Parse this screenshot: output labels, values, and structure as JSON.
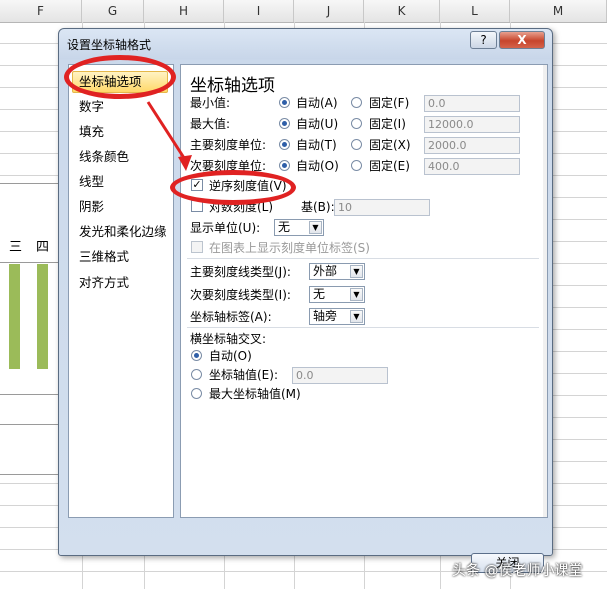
{
  "sheet": {
    "columns": [
      "F",
      "G",
      "H",
      "I",
      "J",
      "K",
      "L",
      "M"
    ],
    "chart_labels": [
      "三",
      "四"
    ]
  },
  "dialog": {
    "title": "设置坐标轴格式",
    "help_label": "?",
    "close_label": "X",
    "nav_items": [
      "坐标轴选项",
      "数字",
      "填充",
      "线条颜色",
      "线型",
      "阴影",
      "发光和柔化边缘",
      "三维格式",
      "对齐方式"
    ],
    "section_title": "坐标轴选项",
    "rows": {
      "min": {
        "label": "最小值:",
        "auto": "自动(A)",
        "fixed": "固定(F)",
        "value": "0.0"
      },
      "max": {
        "label": "最大值:",
        "auto": "自动(U)",
        "fixed": "固定(I)",
        "value": "12000.0"
      },
      "major": {
        "label": "主要刻度单位:",
        "auto": "自动(T)",
        "fixed": "固定(X)",
        "value": "2000.0"
      },
      "minor": {
        "label": "次要刻度单位:",
        "auto": "自动(O)",
        "fixed": "固定(E)",
        "value": "400.0"
      }
    },
    "reverse_label": "逆序刻度值(V)",
    "log_label": "对数刻度(L)",
    "base_label": "基(B):",
    "base_value": "10",
    "display_unit_label": "显示单位(U):",
    "display_unit_value": "无",
    "show_unit_label": "在图表上显示刻度单位标签(S)",
    "major_tick_label": "主要刻度线类型(J):",
    "major_tick_value": "外部",
    "minor_tick_label": "次要刻度线类型(I):",
    "minor_tick_value": "无",
    "axis_label_label": "坐标轴标签(A):",
    "axis_label_value": "轴旁",
    "cross_title": "横坐标轴交叉:",
    "cross_auto": "自动(O)",
    "cross_axis_value": "坐标轴值(E):",
    "cross_axis_input": "0.0",
    "cross_max": "最大坐标轴值(M)",
    "ok_label": "关闭"
  },
  "watermark": "头条 @侯老师小课堂",
  "colors": {
    "annotation": "#e02222",
    "bar": "#9bbb59",
    "selection": "#ffd869"
  }
}
